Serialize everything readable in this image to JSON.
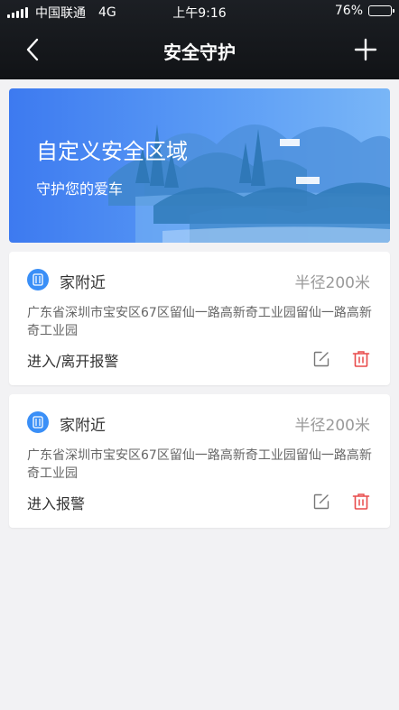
{
  "status_bar": {
    "carrier": "中国联通",
    "network": "4G",
    "time": "上午9:16",
    "battery": "76%",
    "battery_level": 0.76
  },
  "nav": {
    "title": "安全守护",
    "back_icon": "chevron-left-icon",
    "add_icon": "plus-icon"
  },
  "banner": {
    "title": "自定义安全区域",
    "subtitle": "守护您的爱车"
  },
  "zones": [
    {
      "name": "家附近",
      "radius": "半径200米",
      "address": "广东省深圳市宝安区67区留仙一路高新奇工业园留仙一路高新奇工业园",
      "alarm": "进入/离开报警"
    },
    {
      "name": "家附近",
      "radius": "半径200米",
      "address": "广东省深圳市宝安区67区留仙一路高新奇工业园留仙一路高新奇工业园",
      "alarm": "进入报警"
    }
  ],
  "colors": {
    "header_bg": "#15181c",
    "accent_blue": "#3a8ff7",
    "delete_red": "#e84a4a",
    "page_bg": "#f2f2f4"
  }
}
